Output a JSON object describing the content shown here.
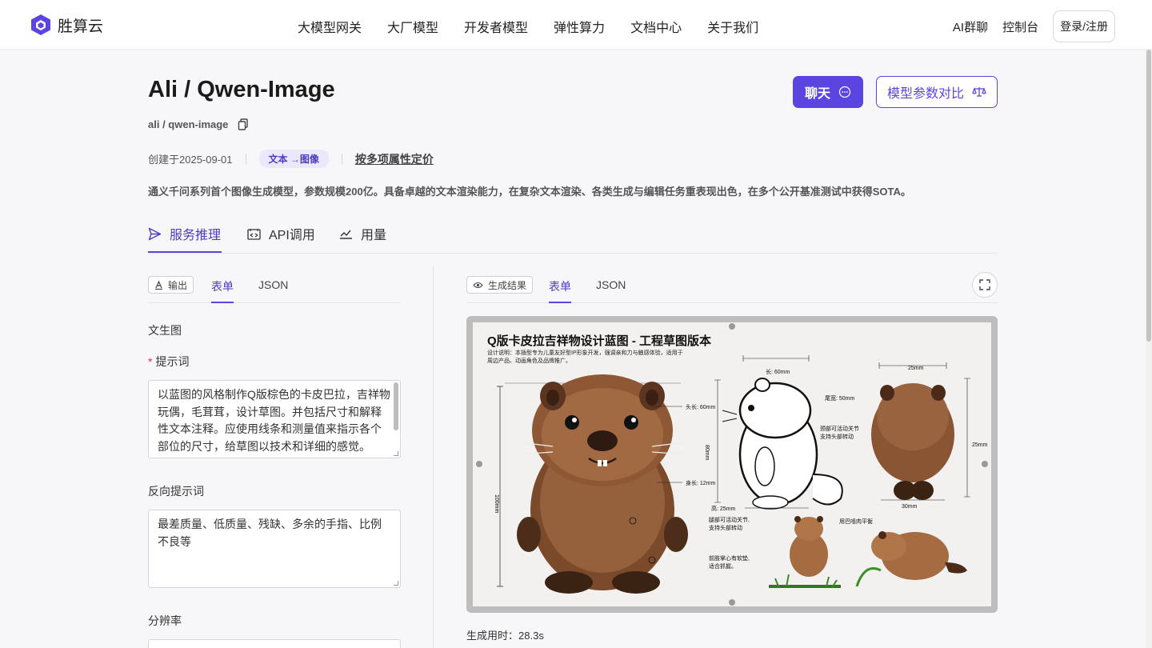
{
  "brand": {
    "name": "胜算云"
  },
  "nav": {
    "items": [
      "大模型网关",
      "大厂模型",
      "开发者模型",
      "弹性算力",
      "文档中心",
      "关于我们"
    ]
  },
  "header_right": {
    "group_chat": "AI群聊",
    "console": "控制台",
    "login": "登录/注册"
  },
  "model": {
    "title": "Ali / Qwen-Image",
    "slug": "ali / qwen-image",
    "created": "创建于2025-09-01",
    "modality_tag": "文本 →图像",
    "pricing_link": "按多项属性定价",
    "description": "通义千问系列首个图像生成模型，参数规模200亿。具备卓越的文本渲染能力，在复杂文本渲染、各类生成与编辑任务重表现出色，在多个公开基准测试中获得SOTA。"
  },
  "actions": {
    "chat": "聊天",
    "compare": "模型参数对比"
  },
  "tabs": {
    "inference": "服务推理",
    "api": "API调用",
    "usage": "用量"
  },
  "input_panel": {
    "pill": "输出",
    "form_tab": "表单",
    "json_tab": "JSON",
    "mode": "文生图",
    "prompt_label": "提示词",
    "prompt_value": "以蓝图的风格制作Q版棕色的卡皮巴拉，吉祥物玩偶，毛茸茸，设计草图。并包括尺寸和解释性文本注释。应使用线条和测量值来指示各个部位的尺寸，给草图以技术和详细的感觉。",
    "negative_label": "反向提示词",
    "negative_value": "最差质量、低质量、残缺、多余的手指、比例不良等",
    "resolution_label": "分辨率"
  },
  "output_panel": {
    "pill": "生成结果",
    "form_tab": "表单",
    "json_tab": "JSON",
    "time_label": "生成用时：",
    "time_value": "28.3s"
  },
  "generated_image": {
    "title": "Q版卡皮拉吉祥物设计蓝图 - 工程草图版本",
    "note": "设计说明：本插型专为儿童友好型IP形象开发，强调亲和力与触感体验，适用于周边产品、动画角色及品牌推广。",
    "annotations": {
      "head": "头长: 60mm",
      "length_top": "长: 60mm",
      "tail": "尾宽: 50mm",
      "joint": "颈部可活动关节\n支持头部转动",
      "body": "身长: 12mm",
      "height_bottom": "高: 25mm",
      "back_width": "25mm",
      "back_height": "25mm",
      "back_bottom": "30mm",
      "front_height": "100mm",
      "side_height": "80mm",
      "limb_joint": "腿部可活动关节,\n支持头部转动",
      "paw": "前肢掌心有软垫,\n适合抓握。",
      "tail_note": "用巴咀肉平衡"
    }
  },
  "colors": {
    "accent": "#5b45e0",
    "tag_bg": "#ebe8fb"
  }
}
